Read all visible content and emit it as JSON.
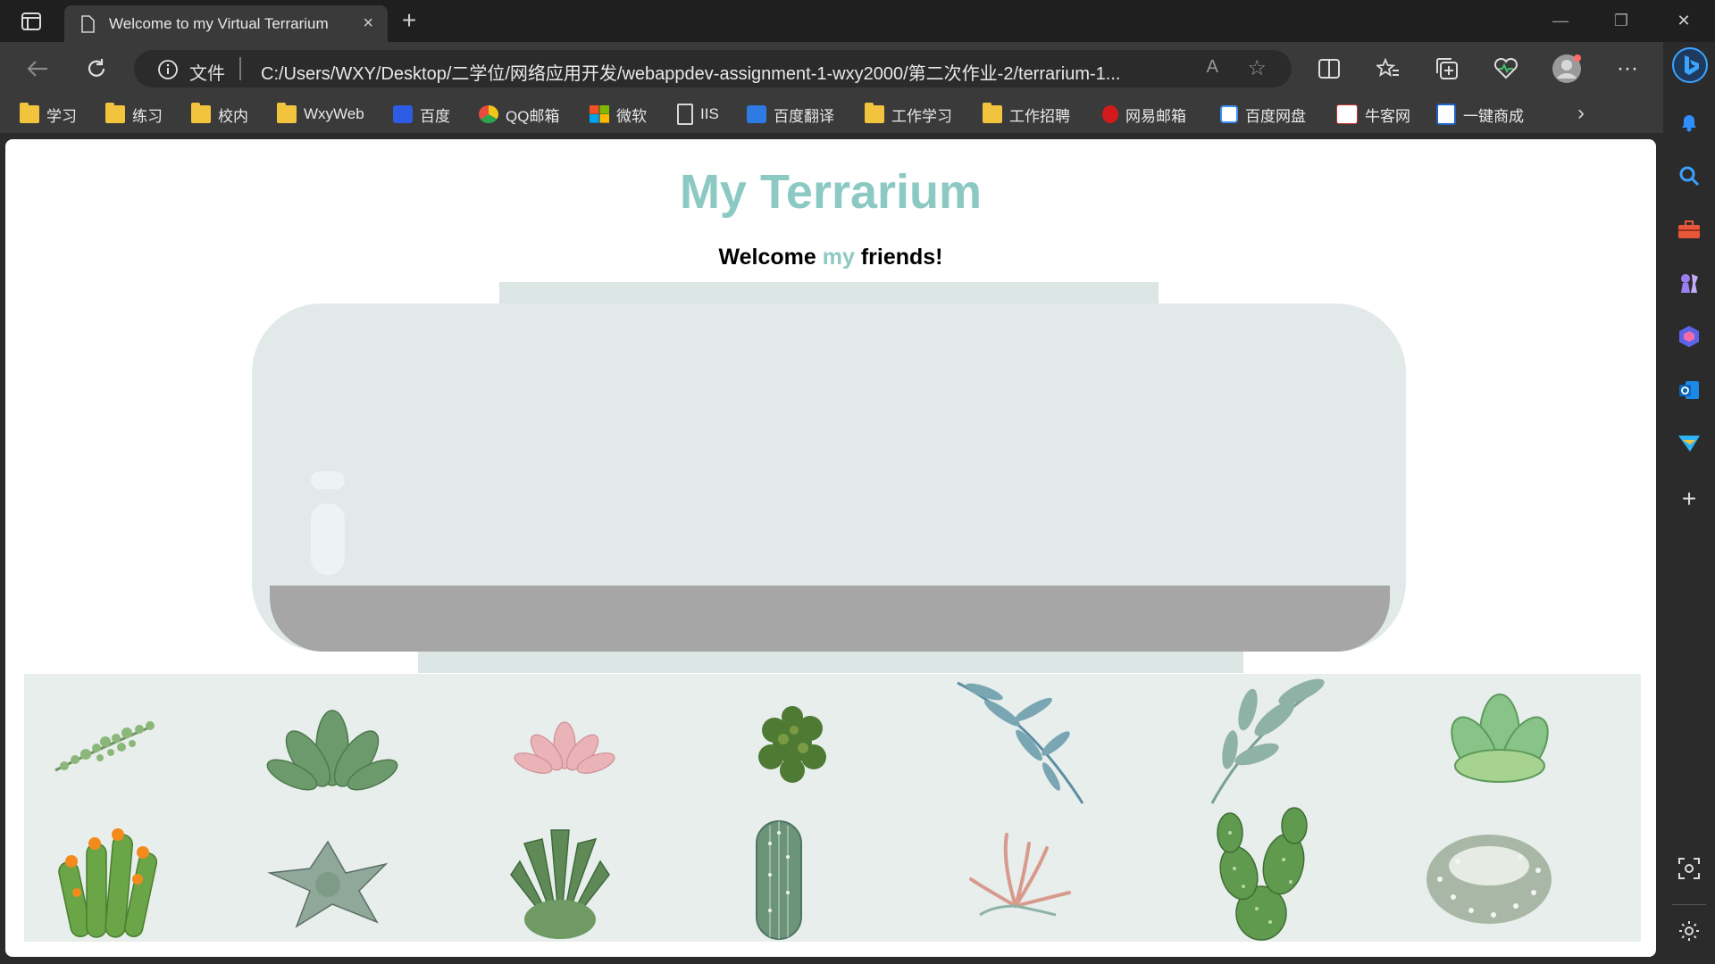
{
  "browser": {
    "tab_title": "Welcome to my Virtual Terrarium",
    "tab_close": "×",
    "new_tab": "+",
    "address": {
      "scheme_label": "文件",
      "url": "C:/Users/WXY/Desktop/二学位/网络应用开发/webappdev-assignment-1-wxy2000/第二次作业-2/terrarium-1...",
      "read_aloud": "A"
    },
    "bookmarks": [
      {
        "label": "学习",
        "icon": "folder-icon"
      },
      {
        "label": "练习",
        "icon": "folder-icon"
      },
      {
        "label": "校内",
        "icon": "folder-icon"
      },
      {
        "label": "WxyWeb",
        "icon": "folder-icon"
      },
      {
        "label": "百度",
        "icon": "baidu-icon"
      },
      {
        "label": "QQ邮箱",
        "icon": "qqmail-icon"
      },
      {
        "label": "微软",
        "icon": "microsoft-icon"
      },
      {
        "label": "IIS",
        "icon": "page-icon"
      },
      {
        "label": "百度翻译",
        "icon": "baidu-translate-icon"
      },
      {
        "label": "工作学习",
        "icon": "folder-icon"
      },
      {
        "label": "工作招聘",
        "icon": "folder-icon"
      },
      {
        "label": "网易邮箱",
        "icon": "netease-mail-icon"
      },
      {
        "label": "百度网盘",
        "icon": "baidu-netdisk-icon"
      },
      {
        "label": "牛客网",
        "icon": "nowcoder-icon"
      },
      {
        "label": "一键商成",
        "icon": "yijian-icon"
      }
    ]
  },
  "page": {
    "title": "My Terrarium",
    "welcome_before": "Welcome ",
    "welcome_accent": "my",
    "welcome_after": " friends!",
    "accent_color": "#8cc9c3",
    "plants": [
      "plant-1",
      "plant-2",
      "plant-3",
      "plant-4",
      "plant-5",
      "plant-6",
      "plant-7",
      "plant-8",
      "plant-9",
      "plant-10",
      "plant-11",
      "plant-12",
      "plant-13",
      "plant-14"
    ]
  }
}
